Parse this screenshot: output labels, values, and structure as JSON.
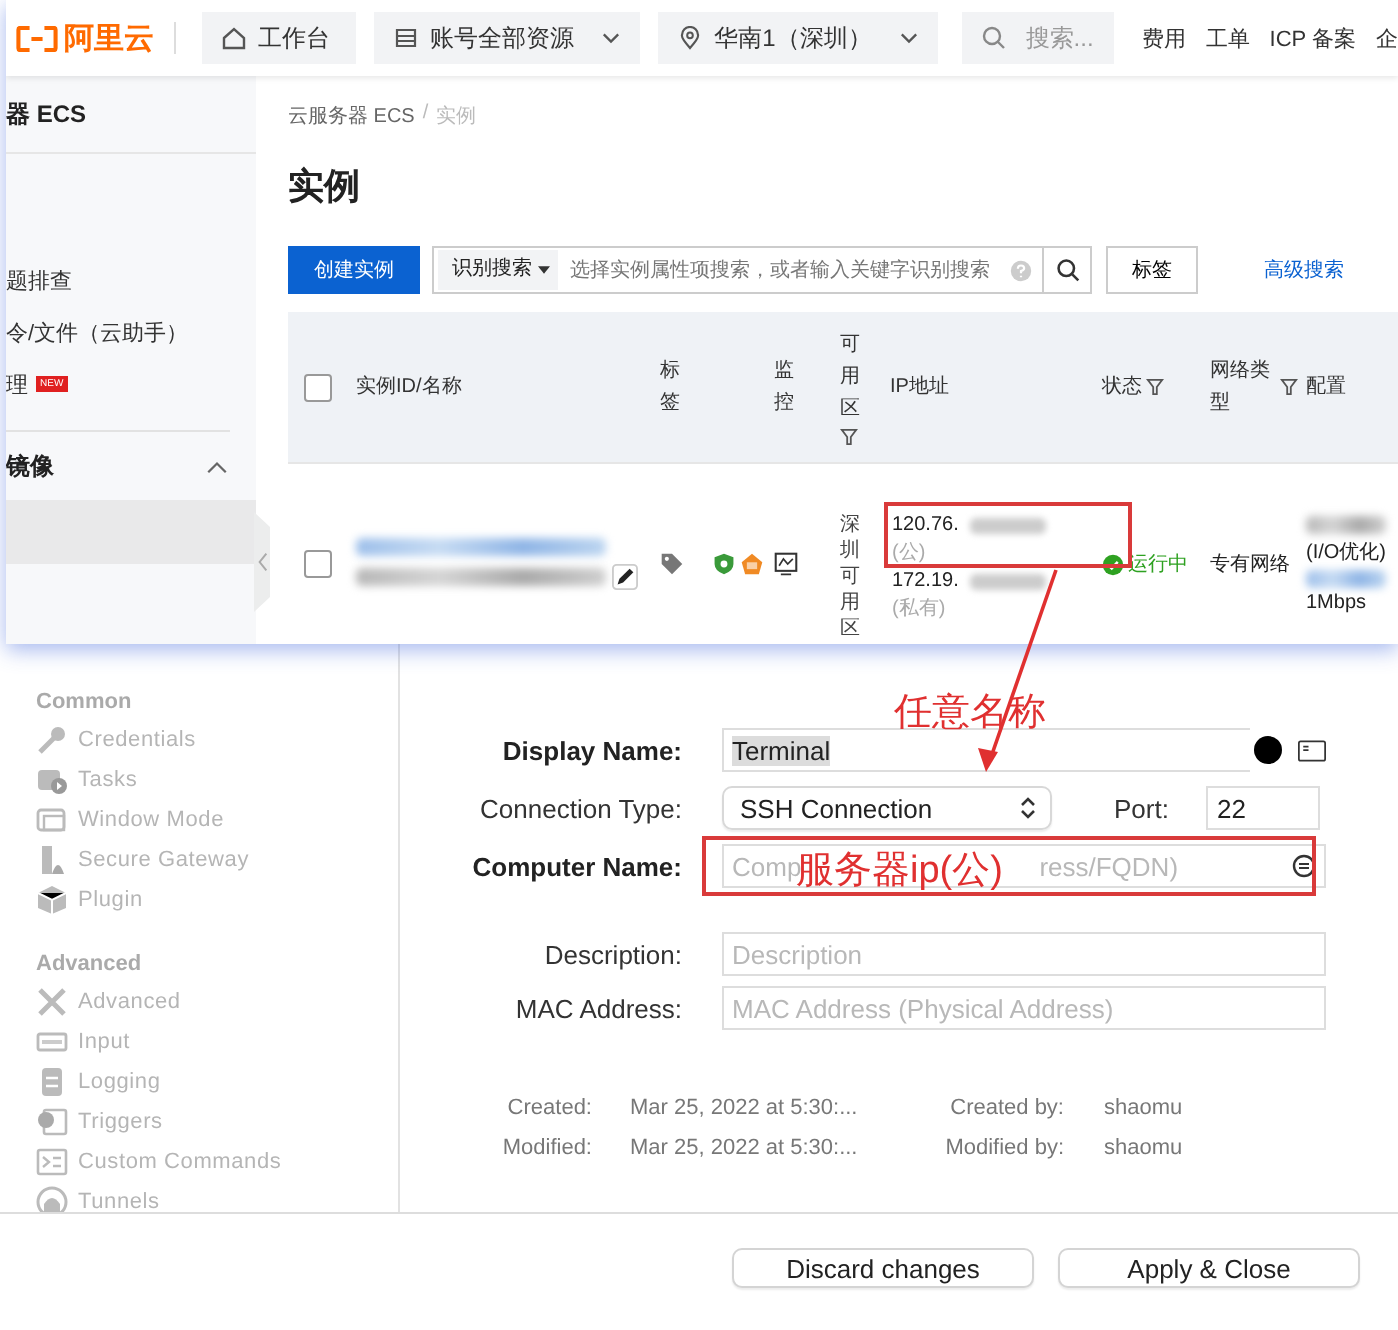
{
  "console": {
    "logo": "阿里云",
    "nav": [
      {
        "kind": "home",
        "label": "工作台",
        "dropdown": false
      },
      {
        "kind": "list",
        "label": "账号全部资源",
        "dropdown": true
      },
      {
        "kind": "pin",
        "label": "华南1（深圳）",
        "dropdown": true
      }
    ],
    "search": {
      "placeholder": "搜索..."
    },
    "links": [
      "费用",
      "工单",
      "ICP 备案",
      "企"
    ],
    "sidebar": {
      "title": "器 ECS",
      "items": [
        {
          "label": "题排查"
        },
        {
          "label": "令/文件（云助手）"
        },
        {
          "label": "理",
          "badge": "NEW"
        }
      ],
      "section": {
        "label": "镜像",
        "expanded": true
      }
    },
    "breadcrumb": [
      "云服务器 ECS",
      "实例"
    ],
    "breadcrumb_separator": "/",
    "title": "实例",
    "create_button": "创建实例",
    "search_bar": {
      "filter": "识别搜索",
      "placeholder": "选择实例属性项搜索，或者输入关键字识别搜索"
    },
    "tag_button": "标签",
    "advanced_link": "高级搜索",
    "table": {
      "header_checked": false,
      "columns": [
        {
          "label": "实例ID/名称",
          "filter": false
        },
        {
          "label": "标签",
          "filter": false
        },
        {
          "label": "监控",
          "filter": false
        },
        {
          "label": "可用区",
          "filter": true
        },
        {
          "label": "IP地址",
          "filter": false
        },
        {
          "label": "状态",
          "filter": true
        },
        {
          "label": "网络类型",
          "filter": true
        },
        {
          "label": "配置",
          "filter": false
        }
      ],
      "row": {
        "checked": false,
        "zone": "深圳可用区",
        "ips": [
          {
            "prefix": "120.76.",
            "type": "(公)"
          },
          {
            "prefix": "172.19.",
            "type": "(私有)"
          }
        ],
        "status": "运行中",
        "network": "专有网络",
        "config": [
          "(I/O优化)",
          "1Mbps"
        ]
      }
    }
  },
  "app": {
    "sidebar": [
      {
        "title": "Common",
        "items": [
          {
            "kind": "key",
            "label": "Credentials"
          },
          {
            "kind": "tasks",
            "label": "Tasks"
          },
          {
            "kind": "window",
            "label": "Window Mode"
          },
          {
            "kind": "gateway",
            "label": "Secure Gateway"
          },
          {
            "kind": "cube",
            "label": "Plugin"
          }
        ]
      },
      {
        "title": "Advanced",
        "items": [
          {
            "kind": "tools",
            "label": "Advanced"
          },
          {
            "kind": "keyboard",
            "label": "Input"
          },
          {
            "kind": "log",
            "label": "Logging"
          },
          {
            "kind": "trigger",
            "label": "Triggers"
          },
          {
            "kind": "prompt",
            "label": "Custom Commands"
          },
          {
            "kind": "tunnel",
            "label": "Tunnels"
          }
        ]
      }
    ],
    "form": {
      "display_name": {
        "label": "Display Name:",
        "value": "Terminal"
      },
      "connection_type": {
        "label": "Connection Type:",
        "value": "SSH Connection"
      },
      "port": {
        "label": "Port:",
        "value": "22"
      },
      "computer_name": {
        "label": "Computer Name:",
        "placeholder_visible": [
          "Comp",
          "ress/FQDN)"
        ]
      },
      "description": {
        "label": "Description:",
        "placeholder": "Description"
      },
      "mac_address": {
        "label": "MAC Address:",
        "placeholder": "MAC Address (Physical Address)"
      }
    },
    "meta": [
      {
        "label": "Created:",
        "value": "Mar 25, 2022 at 5:30:...",
        "by_label": "Created by:",
        "by": "shaomu"
      },
      {
        "label": "Modified:",
        "value": "Mar 25, 2022 at 5:30:...",
        "by_label": "Modified by:",
        "by": "shaomu"
      }
    ],
    "buttons": [
      "Discard changes",
      "Apply & Close"
    ]
  },
  "annotations": [
    "任意名称",
    "服务器ip(公)"
  ]
}
